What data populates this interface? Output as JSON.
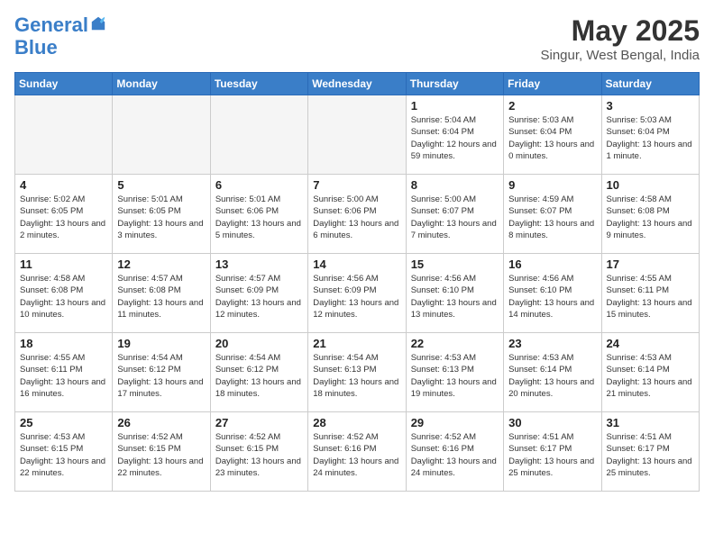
{
  "header": {
    "logo_line1": "General",
    "logo_line2": "Blue",
    "month_year": "May 2025",
    "location": "Singur, West Bengal, India"
  },
  "weekdays": [
    "Sunday",
    "Monday",
    "Tuesday",
    "Wednesday",
    "Thursday",
    "Friday",
    "Saturday"
  ],
  "weeks": [
    [
      {
        "day": "",
        "empty": true
      },
      {
        "day": "",
        "empty": true
      },
      {
        "day": "",
        "empty": true
      },
      {
        "day": "",
        "empty": true
      },
      {
        "day": "1",
        "sunrise": "5:04 AM",
        "sunset": "6:04 PM",
        "daylight": "12 hours and 59 minutes."
      },
      {
        "day": "2",
        "sunrise": "5:03 AM",
        "sunset": "6:04 PM",
        "daylight": "13 hours and 0 minutes."
      },
      {
        "day": "3",
        "sunrise": "5:03 AM",
        "sunset": "6:04 PM",
        "daylight": "13 hours and 1 minute."
      }
    ],
    [
      {
        "day": "4",
        "sunrise": "5:02 AM",
        "sunset": "6:05 PM",
        "daylight": "13 hours and 2 minutes."
      },
      {
        "day": "5",
        "sunrise": "5:01 AM",
        "sunset": "6:05 PM",
        "daylight": "13 hours and 3 minutes."
      },
      {
        "day": "6",
        "sunrise": "5:01 AM",
        "sunset": "6:06 PM",
        "daylight": "13 hours and 5 minutes."
      },
      {
        "day": "7",
        "sunrise": "5:00 AM",
        "sunset": "6:06 PM",
        "daylight": "13 hours and 6 minutes."
      },
      {
        "day": "8",
        "sunrise": "5:00 AM",
        "sunset": "6:07 PM",
        "daylight": "13 hours and 7 minutes."
      },
      {
        "day": "9",
        "sunrise": "4:59 AM",
        "sunset": "6:07 PM",
        "daylight": "13 hours and 8 minutes."
      },
      {
        "day": "10",
        "sunrise": "4:58 AM",
        "sunset": "6:08 PM",
        "daylight": "13 hours and 9 minutes."
      }
    ],
    [
      {
        "day": "11",
        "sunrise": "4:58 AM",
        "sunset": "6:08 PM",
        "daylight": "13 hours and 10 minutes."
      },
      {
        "day": "12",
        "sunrise": "4:57 AM",
        "sunset": "6:08 PM",
        "daylight": "13 hours and 11 minutes."
      },
      {
        "day": "13",
        "sunrise": "4:57 AM",
        "sunset": "6:09 PM",
        "daylight": "13 hours and 12 minutes."
      },
      {
        "day": "14",
        "sunrise": "4:56 AM",
        "sunset": "6:09 PM",
        "daylight": "13 hours and 12 minutes."
      },
      {
        "day": "15",
        "sunrise": "4:56 AM",
        "sunset": "6:10 PM",
        "daylight": "13 hours and 13 minutes."
      },
      {
        "day": "16",
        "sunrise": "4:56 AM",
        "sunset": "6:10 PM",
        "daylight": "13 hours and 14 minutes."
      },
      {
        "day": "17",
        "sunrise": "4:55 AM",
        "sunset": "6:11 PM",
        "daylight": "13 hours and 15 minutes."
      }
    ],
    [
      {
        "day": "18",
        "sunrise": "4:55 AM",
        "sunset": "6:11 PM",
        "daylight": "13 hours and 16 minutes."
      },
      {
        "day": "19",
        "sunrise": "4:54 AM",
        "sunset": "6:12 PM",
        "daylight": "13 hours and 17 minutes."
      },
      {
        "day": "20",
        "sunrise": "4:54 AM",
        "sunset": "6:12 PM",
        "daylight": "13 hours and 18 minutes."
      },
      {
        "day": "21",
        "sunrise": "4:54 AM",
        "sunset": "6:13 PM",
        "daylight": "13 hours and 18 minutes."
      },
      {
        "day": "22",
        "sunrise": "4:53 AM",
        "sunset": "6:13 PM",
        "daylight": "13 hours and 19 minutes."
      },
      {
        "day": "23",
        "sunrise": "4:53 AM",
        "sunset": "6:14 PM",
        "daylight": "13 hours and 20 minutes."
      },
      {
        "day": "24",
        "sunrise": "4:53 AM",
        "sunset": "6:14 PM",
        "daylight": "13 hours and 21 minutes."
      }
    ],
    [
      {
        "day": "25",
        "sunrise": "4:53 AM",
        "sunset": "6:15 PM",
        "daylight": "13 hours and 22 minutes."
      },
      {
        "day": "26",
        "sunrise": "4:52 AM",
        "sunset": "6:15 PM",
        "daylight": "13 hours and 22 minutes."
      },
      {
        "day": "27",
        "sunrise": "4:52 AM",
        "sunset": "6:15 PM",
        "daylight": "13 hours and 23 minutes."
      },
      {
        "day": "28",
        "sunrise": "4:52 AM",
        "sunset": "6:16 PM",
        "daylight": "13 hours and 24 minutes."
      },
      {
        "day": "29",
        "sunrise": "4:52 AM",
        "sunset": "6:16 PM",
        "daylight": "13 hours and 24 minutes."
      },
      {
        "day": "30",
        "sunrise": "4:51 AM",
        "sunset": "6:17 PM",
        "daylight": "13 hours and 25 minutes."
      },
      {
        "day": "31",
        "sunrise": "4:51 AM",
        "sunset": "6:17 PM",
        "daylight": "13 hours and 25 minutes."
      }
    ]
  ],
  "labels": {
    "sunrise_prefix": "Sunrise: ",
    "sunset_prefix": "Sunset: ",
    "daylight_prefix": "Daylight: "
  }
}
